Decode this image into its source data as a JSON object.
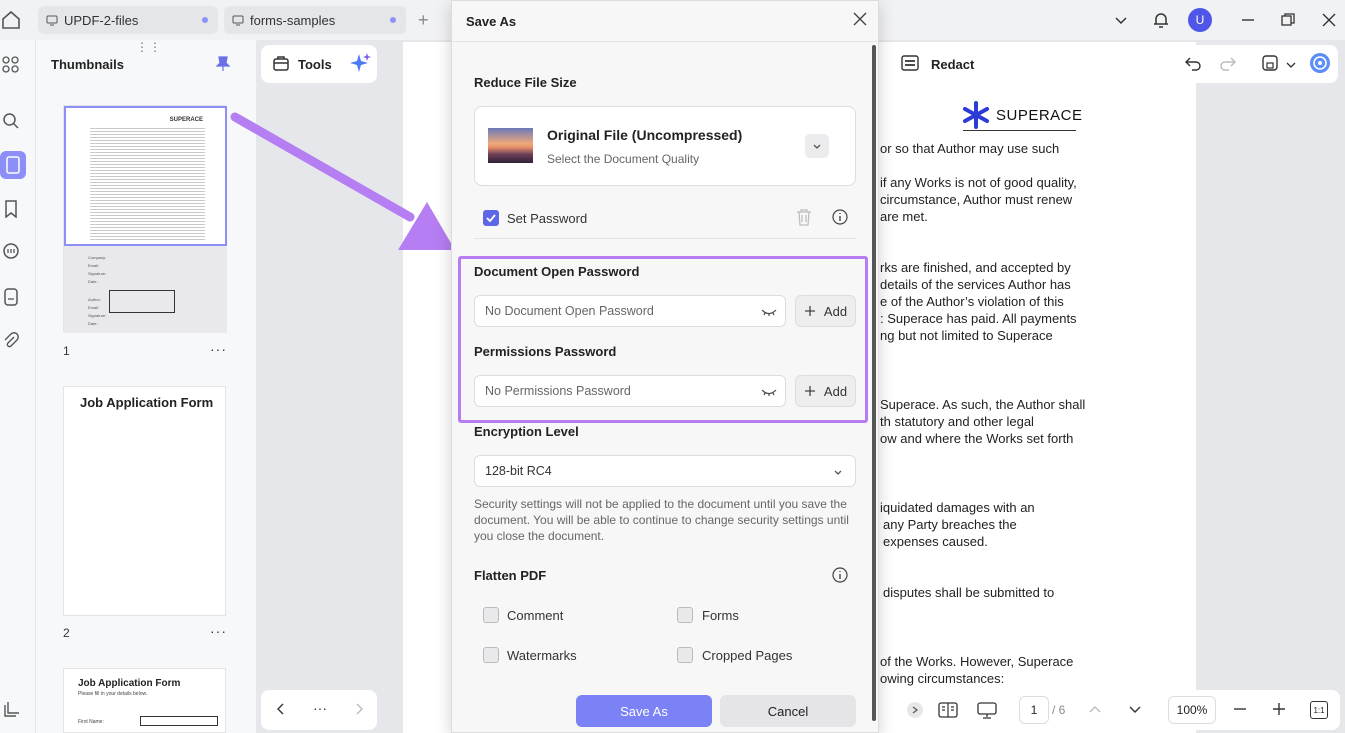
{
  "tabs": [
    {
      "label": "UPDF-2-files"
    },
    {
      "label": "forms-samples"
    }
  ],
  "window": {
    "avatar_letter": "U"
  },
  "sidebar": {
    "title": "Thumbnails",
    "grip": "⋮⋮"
  },
  "thumbnails": [
    {
      "number": "1",
      "more": "···",
      "brand": "SUPERACE",
      "lines": [
        "Company:",
        "Email:",
        "Signature:",
        "Date:",
        "Author:",
        "Email:",
        "Signature:",
        "Date:"
      ]
    },
    {
      "number": "2",
      "more": "···",
      "heading": "Job Application Form"
    },
    {
      "heading": "Job Application Form",
      "subheading": "Please fill in your details below.",
      "first_name": "First Name:"
    }
  ],
  "toolbar": {
    "tools_label": "Tools",
    "redact_label": "Redact"
  },
  "document": {
    "brand": "SUPERACE",
    "lines": [
      "or so that Author may use such",
      "if any Works is not of good quality,",
      "circumstance, Author must renew",
      "are met.",
      "rks are finished, and accepted by",
      "details of the services Author has",
      "e of the Author’s violation of this",
      ": Superace has paid. All payments",
      "ng but not limited to Superace",
      "Superace. As such, the Author shall",
      "th statutory and other legal",
      "ow and where the Works set forth",
      "iquidated damages with an",
      "any Party breaches the",
      "expenses caused.",
      "disputes shall be submitted to",
      "of the Works. However, Superace",
      "owing circumstances:"
    ]
  },
  "pager": {
    "current": "1",
    "total": "/ 6",
    "zoom": "100%",
    "fit": "1:1",
    "more": "···"
  },
  "dialog": {
    "title": "Save As",
    "reduce_size_label": "Reduce File Size",
    "quality_title": "Original File (Uncompressed)",
    "quality_subtitle": "Select the Document Quality",
    "set_password_label": "Set Password",
    "open_password_label": "Document Open Password",
    "open_password_placeholder": "No Document Open Password",
    "permissions_password_label": "Permissions Password",
    "permissions_password_placeholder": "No Permissions Password",
    "add_label": "Add",
    "encryption_label": "Encryption Level",
    "encryption_value": "128-bit RC4",
    "security_note": "Security settings will not be applied to the document until you save the document. You will be able to continue to change security settings until you close the document.",
    "flatten_label": "Flatten PDF",
    "flatten_options": [
      "Comment",
      "Forms",
      "Watermarks",
      "Cropped Pages"
    ],
    "save_button": "Save As",
    "cancel_button": "Cancel"
  },
  "colors": {
    "accent": "#7b82f5",
    "highlight": "#b77cf2",
    "arrow": "#b57ef2"
  }
}
